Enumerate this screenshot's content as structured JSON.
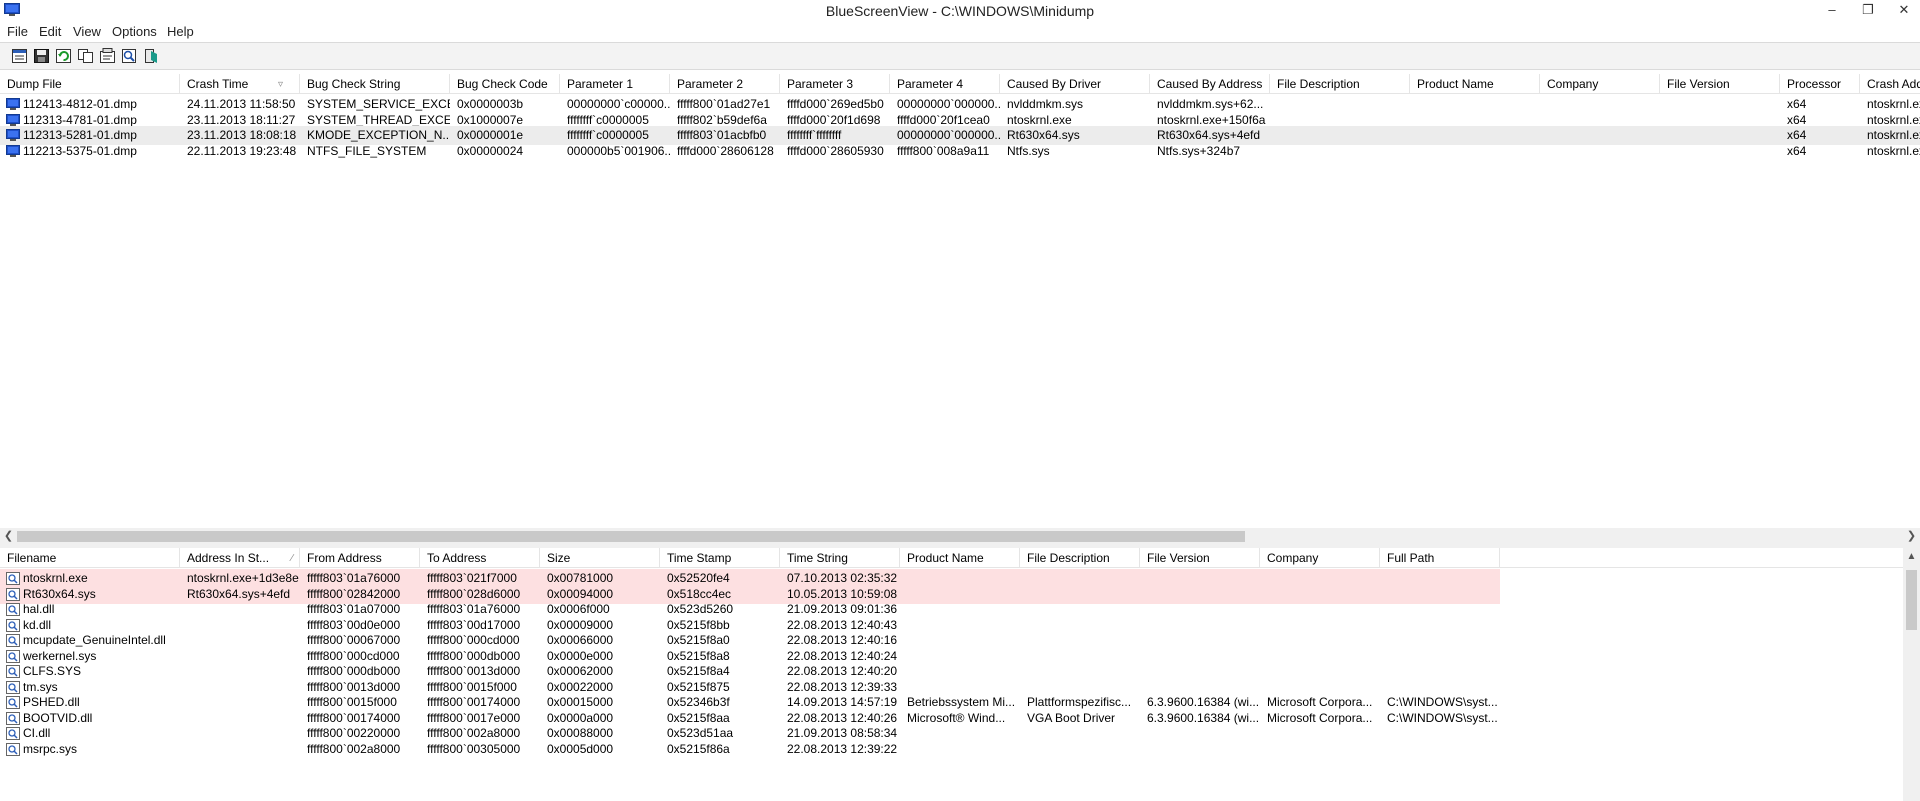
{
  "window": {
    "title": "BlueScreenView  -  C:\\WINDOWS\\Minidump",
    "minimize": "–",
    "maximize": "❐",
    "close": "✕"
  },
  "menu": [
    "File",
    "Edit",
    "View",
    "Options",
    "Help"
  ],
  "toolbar_icons": [
    "properties-icon",
    "save-icon",
    "refresh-icon",
    "copy-icon",
    "html-report-icon",
    "find-icon",
    "exit-icon"
  ],
  "dumps": {
    "columns": [
      "Dump File",
      "Crash Time",
      "Bug Check String",
      "Bug Check Code",
      "Parameter 1",
      "Parameter 2",
      "Parameter 3",
      "Parameter 4",
      "Caused By Driver",
      "Caused By Address",
      "File Description",
      "Product Name",
      "Company",
      "File Version",
      "Processor",
      "Crash Address"
    ],
    "sorted_column": "Crash Time",
    "rows": [
      [
        "112413-4812-01.dmp",
        "24.11.2013 11:58:50",
        "SYSTEM_SERVICE_EXCE...",
        "0x0000003b",
        "00000000`c00000...",
        "fffff800`01ad27e1",
        "ffffd000`269ed5b0",
        "00000000`000000...",
        "nvlddmkm.sys",
        "nvlddmkm.sys+62...",
        "",
        "",
        "",
        "",
        "x64",
        "ntoskrnl.exe"
      ],
      [
        "112313-4781-01.dmp",
        "23.11.2013 18:11:27",
        "SYSTEM_THREAD_EXCE...",
        "0x1000007e",
        "ffffffff`c0000005",
        "fffff802`b59def6a",
        "ffffd000`20f1d698",
        "ffffd000`20f1cea0",
        "ntoskrnl.exe",
        "ntoskrnl.exe+150f6a",
        "",
        "",
        "",
        "",
        "x64",
        "ntoskrnl.exe"
      ],
      [
        "112313-5281-01.dmp",
        "23.11.2013 18:08:18",
        "KMODE_EXCEPTION_N...",
        "0x0000001e",
        "ffffffff`c0000005",
        "fffff803`01acbfb0",
        "ffffffff`ffffffff",
        "00000000`000000...",
        "Rt630x64.sys",
        "Rt630x64.sys+4efd",
        "",
        "",
        "",
        "",
        "x64",
        "ntoskrnl.exe"
      ],
      [
        "112213-5375-01.dmp",
        "22.11.2013 19:23:48",
        "NTFS_FILE_SYSTEM",
        "0x00000024",
        "000000b5`001906...",
        "ffffd000`28606128",
        "ffffd000`28605930",
        "fffff800`008a9a11",
        "Ntfs.sys",
        "Ntfs.sys+324b7",
        "",
        "",
        "",
        "",
        "x64",
        "ntoskrnl.exe"
      ]
    ],
    "selected_row": 2
  },
  "drivers": {
    "columns": [
      "Filename",
      "Address In St...",
      "From Address",
      "To Address",
      "Size",
      "Time Stamp",
      "Time String",
      "Product Name",
      "File Description",
      "File Version",
      "Company",
      "Full Path"
    ],
    "sorted_column": "Address In St...",
    "rows": [
      [
        "ntoskrnl.exe",
        "ntoskrnl.exe+1d3e8e",
        "fffff803`01a76000",
        "fffff803`021f7000",
        "0x00781000",
        "0x52520fe4",
        "07.10.2013 02:35:32",
        "",
        "",
        "",
        "",
        ""
      ],
      [
        "Rt630x64.sys",
        "Rt630x64.sys+4efd",
        "fffff800`02842000",
        "fffff800`028d6000",
        "0x00094000",
        "0x518cc4ec",
        "10.05.2013 10:59:08",
        "",
        "",
        "",
        "",
        ""
      ],
      [
        "hal.dll",
        "",
        "fffff803`01a07000",
        "fffff803`01a76000",
        "0x0006f000",
        "0x523d5260",
        "21.09.2013 09:01:36",
        "",
        "",
        "",
        "",
        ""
      ],
      [
        "kd.dll",
        "",
        "fffff803`00d0e000",
        "fffff803`00d17000",
        "0x00009000",
        "0x5215f8bb",
        "22.08.2013 12:40:43",
        "",
        "",
        "",
        "",
        ""
      ],
      [
        "mcupdate_GenuineIntel.dll",
        "",
        "fffff800`00067000",
        "fffff800`000cd000",
        "0x00066000",
        "0x5215f8a0",
        "22.08.2013 12:40:16",
        "",
        "",
        "",
        "",
        ""
      ],
      [
        "werkernel.sys",
        "",
        "fffff800`000cd000",
        "fffff800`000db000",
        "0x0000e000",
        "0x5215f8a8",
        "22.08.2013 12:40:24",
        "",
        "",
        "",
        "",
        ""
      ],
      [
        "CLFS.SYS",
        "",
        "fffff800`000db000",
        "fffff800`0013d000",
        "0x00062000",
        "0x5215f8a4",
        "22.08.2013 12:40:20",
        "",
        "",
        "",
        "",
        ""
      ],
      [
        "tm.sys",
        "",
        "fffff800`0013d000",
        "fffff800`0015f000",
        "0x00022000",
        "0x5215f875",
        "22.08.2013 12:39:33",
        "",
        "",
        "",
        "",
        ""
      ],
      [
        "PSHED.dll",
        "",
        "fffff800`0015f000",
        "fffff800`00174000",
        "0x00015000",
        "0x52346b3f",
        "14.09.2013 14:57:19",
        "Betriebssystem Mi...",
        "Plattformspezifisc...",
        "6.3.9600.16384 (wi...",
        "Microsoft Corpora...",
        "C:\\WINDOWS\\syst..."
      ],
      [
        "BOOTVID.dll",
        "",
        "fffff800`00174000",
        "fffff800`0017e000",
        "0x0000a000",
        "0x5215f8aa",
        "22.08.2013 12:40:26",
        "Microsoft® Wind...",
        "VGA Boot Driver",
        "6.3.9600.16384 (wi...",
        "Microsoft Corpora...",
        "C:\\WINDOWS\\syst..."
      ],
      [
        "CI.dll",
        "",
        "fffff800`00220000",
        "fffff800`002a8000",
        "0x00088000",
        "0x523d51aa",
        "21.09.2013 08:58:34",
        "",
        "",
        "",
        "",
        ""
      ],
      [
        "msrpc.sys",
        "",
        "fffff800`002a8000",
        "fffff800`00305000",
        "0x0005d000",
        "0x5215f86a",
        "22.08.2013 12:39:22",
        "",
        "",
        "",
        "",
        ""
      ]
    ],
    "highlighted_rows": [
      0,
      1
    ]
  },
  "colors": {
    "selected_row": "#ececec",
    "highlight_row": "#fde0e1",
    "scroll_thumb": "#c9c9c9"
  }
}
